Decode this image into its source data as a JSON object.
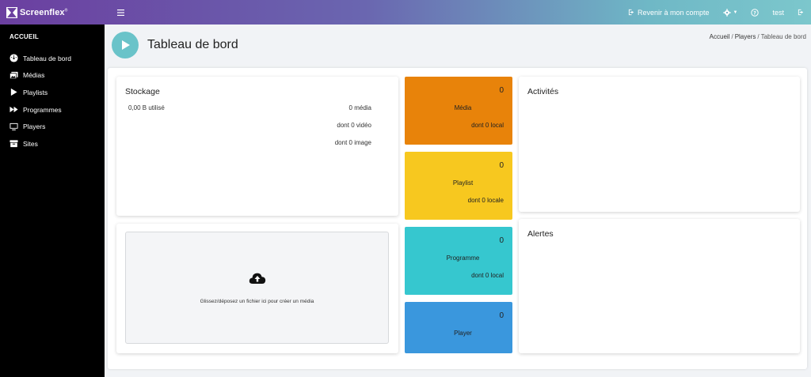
{
  "app": {
    "name": "Screenflex",
    "mark": "®"
  },
  "topbar": {
    "return_label": "Revenir à mon compte",
    "user": "test"
  },
  "sidebar": {
    "heading": "ACCUEIL",
    "items": [
      {
        "label": "Tableau de bord",
        "icon": "dashboard-icon"
      },
      {
        "label": "Médias",
        "icon": "images-icon"
      },
      {
        "label": "Playlists",
        "icon": "play-icon"
      },
      {
        "label": "Programmes",
        "icon": "fast-forward-icon"
      },
      {
        "label": "Players",
        "icon": "monitor-icon"
      },
      {
        "label": "Sites",
        "icon": "archive-icon"
      }
    ]
  },
  "header": {
    "title": "Tableau de bord",
    "breadcrumb": {
      "home": "Accueil",
      "players": "Players",
      "current": "Tableau de bord"
    }
  },
  "storage": {
    "title": "Stockage",
    "used": "0,00 B utilisé",
    "media": "0 média",
    "video": "dont 0 vidéo",
    "image": "dont 0 image"
  },
  "dropzone": {
    "text": "Glissez/déposez un fichier ici pour créer un média"
  },
  "stats": [
    {
      "value": "0",
      "label": "Média",
      "sub": "dont 0 local",
      "color": "#e8830a"
    },
    {
      "value": "0",
      "label": "Playlist",
      "sub": "dont 0 locale",
      "color": "#f7c81f"
    },
    {
      "value": "0",
      "label": "Programme",
      "sub": "dont 0 local",
      "color": "#36c7cf"
    },
    {
      "value": "0",
      "label": "Player",
      "sub": "",
      "color": "#3a97dd"
    }
  ],
  "activities": {
    "title": "Activités"
  },
  "alerts": {
    "title": "Alertes"
  }
}
